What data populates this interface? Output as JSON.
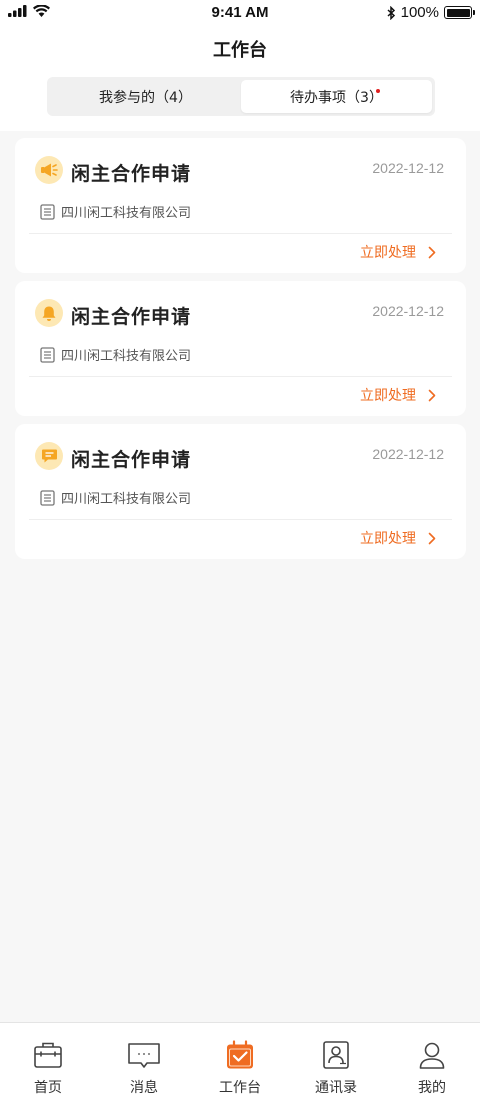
{
  "status_bar": {
    "time": "9:41 AM",
    "battery": "100%"
  },
  "header": {
    "title": "工作台"
  },
  "segments": [
    {
      "label": "我参与的（4）",
      "active": false
    },
    {
      "label": "待办事项（3）",
      "active": true,
      "has_dot": true
    }
  ],
  "cards": [
    {
      "icon": "megaphone-icon",
      "title": "闲主合作申请",
      "date": "2022-12-12",
      "company": "四川闲工科技有限公司",
      "action": "立即处理"
    },
    {
      "icon": "bell-icon",
      "title": "闲主合作申请",
      "date": "2022-12-12",
      "company": "四川闲工科技有限公司",
      "action": "立即处理"
    },
    {
      "icon": "message-icon",
      "title": "闲主合作申请",
      "date": "2022-12-12",
      "company": "四川闲工科技有限公司",
      "action": "立即处理"
    }
  ],
  "tabbar": [
    {
      "label": "首页",
      "icon": "briefcase-icon",
      "active": false
    },
    {
      "label": "消息",
      "icon": "chat-icon",
      "active": false
    },
    {
      "label": "工作台",
      "icon": "calendar-check-icon",
      "active": true
    },
    {
      "label": "通讯录",
      "icon": "contacts-icon",
      "active": false
    },
    {
      "label": "我的",
      "icon": "user-icon",
      "active": false
    }
  ],
  "colors": {
    "accent": "#ef6c22",
    "icon_bg": "#fde8b4",
    "icon_fg": "#f5a623",
    "background": "#f7f7f7"
  }
}
